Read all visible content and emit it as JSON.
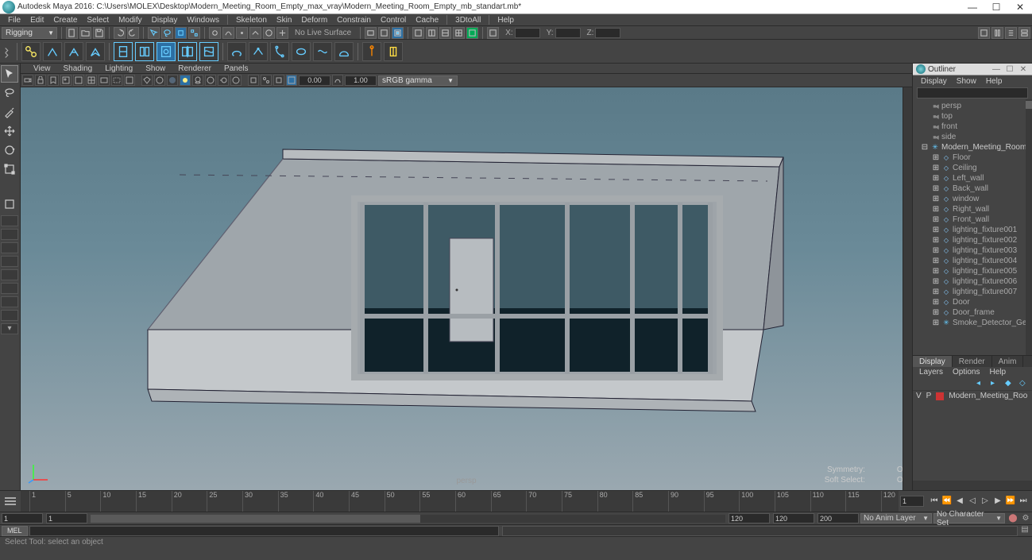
{
  "title": "Autodesk Maya 2016: C:\\Users\\MOLEX\\Desktop\\Modern_Meeting_Room_Empty_max_vray\\Modern_Meeting_Room_Empty_mb_standart.mb*",
  "menu": [
    "File",
    "Edit",
    "Create",
    "Select",
    "Modify",
    "Display",
    "Windows",
    "Skeleton",
    "Skin",
    "Deform",
    "Constrain",
    "Control",
    "Cache",
    "3DtoAll",
    "Help"
  ],
  "module": "Rigging",
  "no_live": "No Live Surface",
  "coords": {
    "x_label": "X:",
    "x_val": "",
    "y_label": "Y:",
    "y_val": "",
    "z_label": "Z:",
    "z_val": ""
  },
  "panel_menu": [
    "View",
    "Shading",
    "Lighting",
    "Show",
    "Renderer",
    "Panels"
  ],
  "panel_inputs": {
    "a": "0.00",
    "b": "1.00"
  },
  "colorspace": "sRGB gamma",
  "viewport": {
    "label": "persp",
    "symmetry_label": "Symmetry:",
    "symmetry_val": "Off",
    "soft_label": "Soft Select:",
    "soft_val": "Off"
  },
  "outliner": {
    "title": "Outliner",
    "menu": [
      "Display",
      "Show",
      "Help"
    ],
    "cameras": [
      "persp",
      "top",
      "front",
      "side"
    ],
    "root": "Modern_Meeting_Room_",
    "children": [
      "Floor",
      "Ceiling",
      "Left_wall",
      "Back_wall",
      "window",
      "Right_wall",
      "Front_wall",
      "lighting_fixture001",
      "lighting_fixture002",
      "lighting_fixture003",
      "lighting_fixture004",
      "lighting_fixture005",
      "lighting_fixture006",
      "lighting_fixture007",
      "Door",
      "Door_frame",
      "Smoke_Detector_Gen"
    ]
  },
  "channel": {
    "tabs": [
      "Display",
      "Render",
      "Anim"
    ],
    "menu": [
      "Layers",
      "Options",
      "Help"
    ],
    "layer_v": "V",
    "layer_p": "P",
    "layer_name": "Modern_Meeting_Roo"
  },
  "timeline": {
    "start": "1",
    "cur": "1",
    "ticks": [
      "1",
      "5",
      "10",
      "15",
      "20",
      "25",
      "30",
      "35",
      "40",
      "45",
      "50",
      "55",
      "60",
      "65",
      "70",
      "75",
      "80",
      "85",
      "90",
      "95",
      "100",
      "105",
      "110",
      "115",
      "120"
    ],
    "frame_box": "1"
  },
  "range": {
    "a": "1",
    "b": "1",
    "c": "120",
    "d": "120",
    "e": "200",
    "anim_layer": "No Anim Layer",
    "char_set": "No Character Set"
  },
  "cmd": {
    "lang": "MEL"
  },
  "help": "Select Tool: select an object"
}
